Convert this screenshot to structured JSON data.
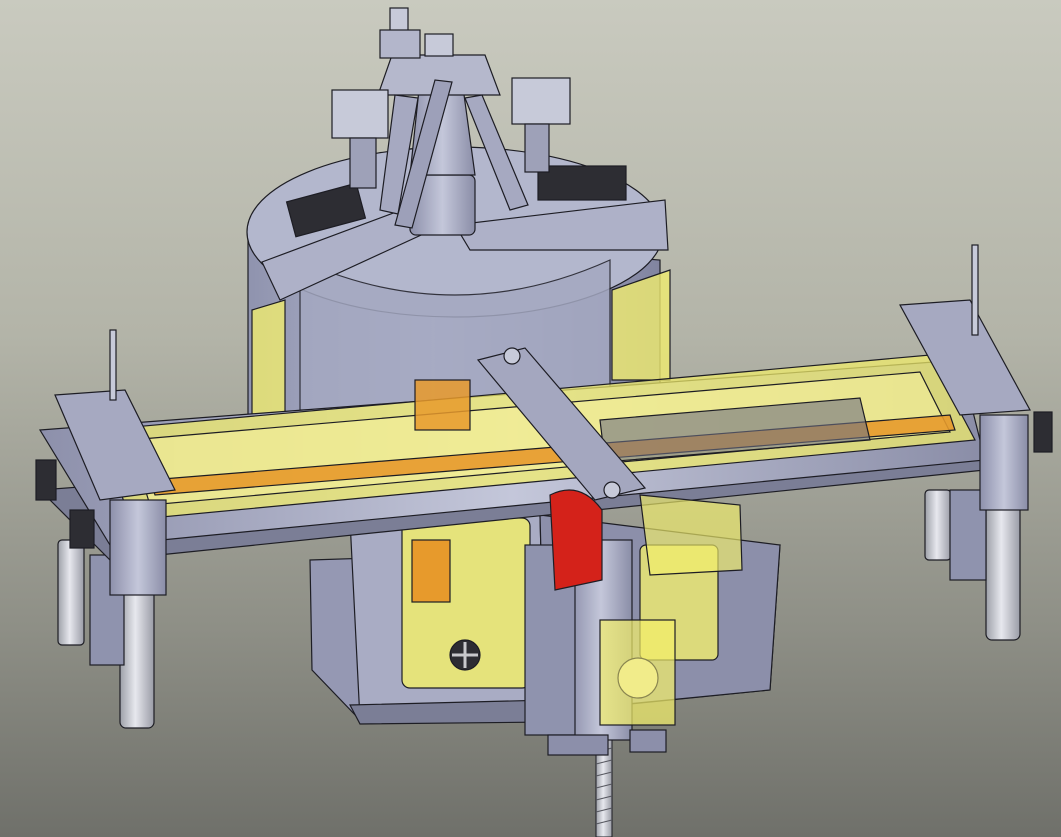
{
  "colors": {
    "background_top": "#c9cabf",
    "background_bottom": "#6f706a",
    "steel": "#a3a6bf",
    "steel_light": "#c3c6d8",
    "steel_dark": "#7b7e96",
    "transparent_yellow": "#f3ef6a",
    "orange": "#e79a2c",
    "red": "#d4221a",
    "edge": "#1d1d24"
  },
  "scene": {
    "subject": "cad-assembly-render",
    "components": [
      "upper-turret",
      "gripper-linkage",
      "cylindrical-housing",
      "transverse-beam",
      "yellow-transparent-cover",
      "rotating-arm",
      "lower-frame",
      "support-legs",
      "red-worm-gear",
      "lead-screw"
    ]
  }
}
